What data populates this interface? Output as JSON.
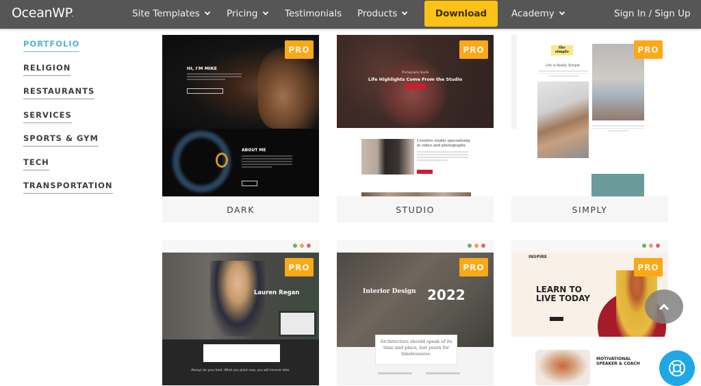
{
  "nav": {
    "logo": "OceanWP",
    "logo_dot": ".",
    "items": [
      {
        "label": "Site Templates",
        "has_dropdown": true
      },
      {
        "label": "Pricing",
        "has_dropdown": true
      },
      {
        "label": "Testimonials",
        "has_dropdown": false
      },
      {
        "label": "Products",
        "has_dropdown": true
      },
      {
        "label": "Academy",
        "has_dropdown": true
      }
    ],
    "download_label": "Download",
    "signin_label": "Sign In / Sign Up",
    "colors": {
      "bar": "#565656",
      "download": "#fcc217",
      "accent": "#13aff0"
    }
  },
  "sidebar": {
    "active": "PORTFOLIO",
    "items": [
      {
        "label": "PORTFOLIO"
      },
      {
        "label": "RELIGION"
      },
      {
        "label": "RESTAURANTS"
      },
      {
        "label": "SERVICES"
      },
      {
        "label": "SPORTS & GYM"
      },
      {
        "label": "TECH"
      },
      {
        "label": "TRANSPORTATION"
      }
    ]
  },
  "badge": "PRO",
  "templates": [
    {
      "name": "DARK",
      "preview": {
        "heading": "HI, I'M MIKE",
        "about": "ABOUT ME"
      }
    },
    {
      "name": "STUDIO",
      "preview": {
        "kicker": "Photography Studio",
        "heading": "Life Highlights Come From the Studio",
        "subheading": "Creative studio specializing in video and photography"
      }
    },
    {
      "name": "SIMPLY",
      "preview": {
        "logo": "the simple",
        "tagline": "Life is Really Simple"
      }
    },
    {
      "name": "",
      "preview": {
        "heading": "Lauren Regan",
        "quote": "Always do your best. What you plant now, you will harvest later."
      }
    },
    {
      "name": "",
      "preview": {
        "heading": "Interior Design",
        "year": "2022",
        "quote": "Architecture should speak of its time and place, but yearn for timelessness."
      }
    },
    {
      "name": "",
      "preview": {
        "logo": "INSPIRE",
        "heading": "LEARN TO LIVE TODAY",
        "subheading": "MOTIVATIONAL SPEAKER & COACH"
      }
    }
  ],
  "browser_dots": [
    "#6bb35a",
    "#e2a95a",
    "#d66a6a"
  ],
  "floating": {
    "scroll_top": "scroll-to-top",
    "help": "help-support"
  }
}
